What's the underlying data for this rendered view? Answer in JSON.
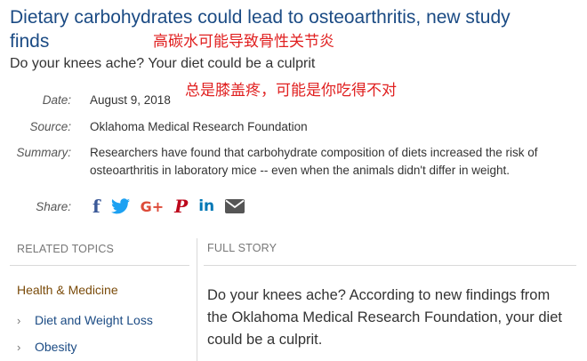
{
  "article": {
    "title": "Dietary carbohydrates could lead to osteoarthritis, new study finds",
    "subtitle": "Do your knees ache? Your diet could be a culprit",
    "annotation_title_cn": "高碳水可能导致骨性关节炎",
    "annotation_subtitle_cn": "总是膝盖疼，可能是你吃得不对",
    "date_label": "Date:",
    "date": "August 9, 2018",
    "source_label": "Source:",
    "source": "Oklahoma Medical Research Foundation",
    "summary_label": "Summary:",
    "summary": "Researchers have found that carbohydrate composition of diets increased the risk of osteoarthritis in laboratory mice -- even when the animals didn't differ in weight.",
    "share_label": "Share:"
  },
  "share_icons": [
    "facebook-icon",
    "twitter-icon",
    "google-plus-icon",
    "pinterest-icon",
    "linkedin-icon",
    "email-icon"
  ],
  "related": {
    "heading": "RELATED TOPICS",
    "category": "Health & Medicine",
    "topics": [
      "Diet and Weight Loss",
      "Obesity"
    ]
  },
  "story": {
    "heading": "FULL STORY",
    "text": "Do your knees ache? According to new findings from the Oklahoma Medical Research Foundation, your diet could be a culprit."
  },
  "colors": {
    "title": "#1b4b84",
    "annotation": "#e02020",
    "facebook": "#3b5998",
    "twitter": "#1da1f2",
    "google_plus": "#dd4b39",
    "pinterest": "#bd081c",
    "linkedin": "#0077b5",
    "email": "#555555"
  }
}
